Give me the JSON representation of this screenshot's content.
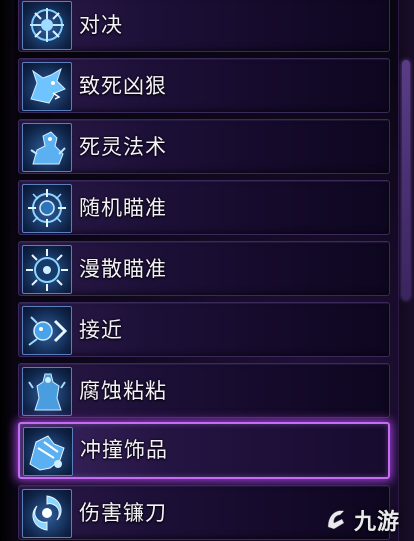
{
  "skill_list": {
    "items": [
      {
        "label": "对决",
        "icon": "duel-icon",
        "selected": false
      },
      {
        "label": "致死凶狠",
        "icon": "wolf-icon",
        "selected": false
      },
      {
        "label": "死灵法术",
        "icon": "necromancy-icon",
        "selected": false
      },
      {
        "label": "随机瞄准",
        "icon": "random-aim-icon",
        "selected": false
      },
      {
        "label": "漫散瞄准",
        "icon": "scatter-aim-icon",
        "selected": false
      },
      {
        "label": "接近",
        "icon": "approach-icon",
        "selected": false
      },
      {
        "label": "腐蚀粘粘",
        "icon": "corrosive-sticky-icon",
        "selected": false
      },
      {
        "label": "冲撞饰品",
        "icon": "charge-trinket-icon",
        "selected": true
      },
      {
        "label": "伤害镰刀",
        "icon": "damage-scythe-icon",
        "selected": false
      }
    ]
  },
  "colors": {
    "selected_border": "#c46df0",
    "icon_blue": "#5fb4ff",
    "row_bg": "#1d1038"
  },
  "watermark": {
    "text": "九游",
    "logo": "jiuyou-logo"
  }
}
